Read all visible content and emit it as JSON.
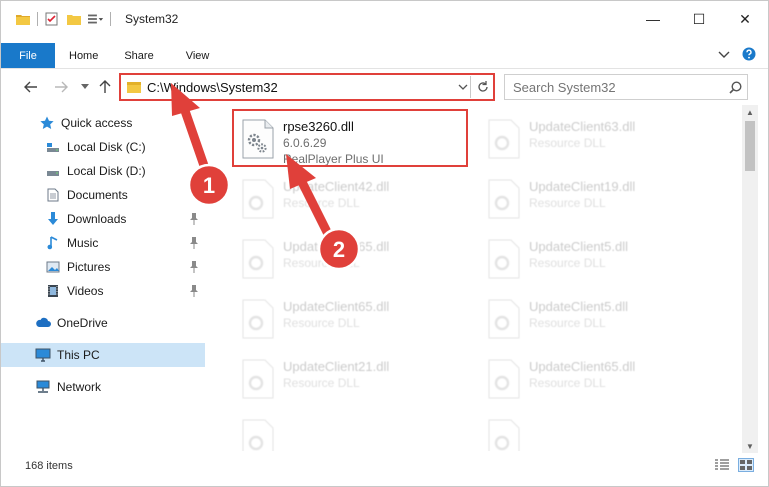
{
  "window": {
    "title": "System32",
    "controls": {
      "minimize": "—",
      "maximize": "☐",
      "close": "✕"
    }
  },
  "ribbon": {
    "tabs": [
      {
        "label": "File",
        "active": true
      },
      {
        "label": "Home"
      },
      {
        "label": "Share"
      },
      {
        "label": "View"
      }
    ]
  },
  "address": {
    "path": "C:\\Windows\\System32",
    "search_placeholder": "Search System32"
  },
  "sidebar": {
    "items": [
      {
        "label": "Quick access",
        "icon": "star-icon"
      },
      {
        "label": "Local Disk (C:)",
        "icon": "drive-icon"
      },
      {
        "label": "Local Disk (D:)",
        "icon": "drive-icon"
      },
      {
        "label": "Documents",
        "icon": "documents-icon"
      },
      {
        "label": "Downloads",
        "icon": "download-icon",
        "pinned": true
      },
      {
        "label": "Music",
        "icon": "music-icon",
        "pinned": true
      },
      {
        "label": "Pictures",
        "icon": "pictures-icon",
        "pinned": true
      },
      {
        "label": "Videos",
        "icon": "videos-icon",
        "pinned": true
      },
      {
        "label": "OneDrive",
        "icon": "cloud-icon"
      },
      {
        "label": "This PC",
        "icon": "computer-icon",
        "selected": true
      },
      {
        "label": "Network",
        "icon": "network-icon"
      }
    ]
  },
  "files": {
    "highlighted": {
      "name": "rpse3260.dll",
      "version": "6.0.6.29",
      "description": "RealPlayer Plus UI"
    },
    "others": [
      {
        "name": "UpdateClient63.dll",
        "type": "Resource DLL"
      },
      {
        "name": "UpdateClient42.dll",
        "type": "Resource DLL"
      },
      {
        "name": "UpdateClient19.dll",
        "type": "Resource DLL"
      },
      {
        "name": "UpdateClient65.dll",
        "type": "Resource DLL"
      },
      {
        "name": "UpdateClient5.dll",
        "type": "Resource DLL"
      },
      {
        "name": "UpdateClient65.dll",
        "type": "Resource DLL"
      },
      {
        "name": "UpdateClient5.dll",
        "type": "Resource DLL"
      },
      {
        "name": "UpdateClient21.dll",
        "type": "Resource DLL"
      },
      {
        "name": "UpdateClient65.dll",
        "type": "Resource DLL"
      }
    ]
  },
  "status": {
    "count": "168 items"
  },
  "annotations": {
    "step1": "1",
    "step2": "2",
    "color": "#e0403a"
  }
}
